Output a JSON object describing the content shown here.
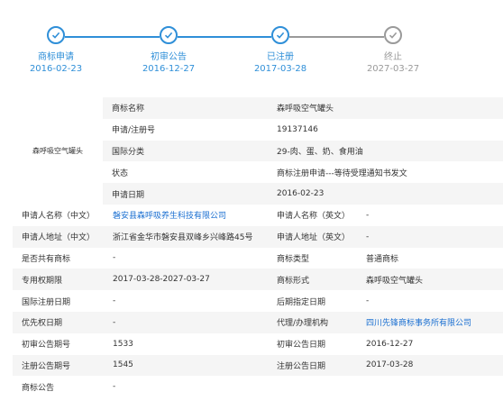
{
  "colors": {
    "active": "#2f8fd8",
    "inactive": "#9a9a9a",
    "link": "#1a6fd1",
    "shade": "#f5f5f5"
  },
  "timeline": [
    {
      "label": "商标申请",
      "date": "2016-02-23",
      "status": "done",
      "icon": "check-icon"
    },
    {
      "label": "初审公告",
      "date": "2016-12-27",
      "status": "done",
      "icon": "check-icon"
    },
    {
      "label": "已注册",
      "date": "2017-03-28",
      "status": "done",
      "icon": "check-icon"
    },
    {
      "label": "终止",
      "date": "2027-03-27",
      "status": "pending",
      "icon": "check-icon"
    }
  ],
  "mark_image_text": "森呼吸空气罐头",
  "basic_rows": [
    {
      "label": "商标名称",
      "value": "森呼吸空气罐头"
    },
    {
      "label": "申请/注册号",
      "value": "19137146"
    },
    {
      "label": "国际分类",
      "value": "29-肉、蛋、奶、食用油"
    },
    {
      "label": "状态",
      "value": "商标注册申请---等待受理通知书发文"
    },
    {
      "label": "申请日期",
      "value": "2016-02-23"
    }
  ],
  "detail_rows": [
    {
      "l1": "申请人名称（中文）",
      "v1": "磐安县森呼吸养生科技有限公司",
      "v1_link": true,
      "l2": "申请人名称（英文）",
      "v2": "-",
      "v2_link": false
    },
    {
      "l1": "申请人地址（中文）",
      "v1": "浙江省金华市磐安县双峰乡兴峰路45号",
      "v1_link": false,
      "l2": "申请人地址（英文）",
      "v2": "-",
      "v2_link": false
    },
    {
      "l1": "是否共有商标",
      "v1": "-",
      "v1_link": false,
      "l2": "商标类型",
      "v2": "普通商标",
      "v2_link": false
    },
    {
      "l1": "专用权期限",
      "v1": "2017-03-28-2027-03-27",
      "v1_link": false,
      "l2": "商标形式",
      "v2": "森呼吸空气罐头",
      "v2_link": false
    },
    {
      "l1": "国际注册日期",
      "v1": "-",
      "v1_link": false,
      "l2": "后期指定日期",
      "v2": "-",
      "v2_link": false
    },
    {
      "l1": "优先权日期",
      "v1": "-",
      "v1_link": false,
      "l2": "代理/办理机构",
      "v2": "四川先锋商标事务所有限公司",
      "v2_link": true
    },
    {
      "l1": "初审公告期号",
      "v1": "1533",
      "v1_link": false,
      "l2": "初审公告日期",
      "v2": "2016-12-27",
      "v2_link": false
    },
    {
      "l1": "注册公告期号",
      "v1": "1545",
      "v1_link": false,
      "l2": "注册公告日期",
      "v2": "2017-03-28",
      "v2_link": false
    },
    {
      "l1": "商标公告",
      "v1": "-",
      "v1_link": false,
      "l2": "",
      "v2": "",
      "v2_link": false
    }
  ]
}
